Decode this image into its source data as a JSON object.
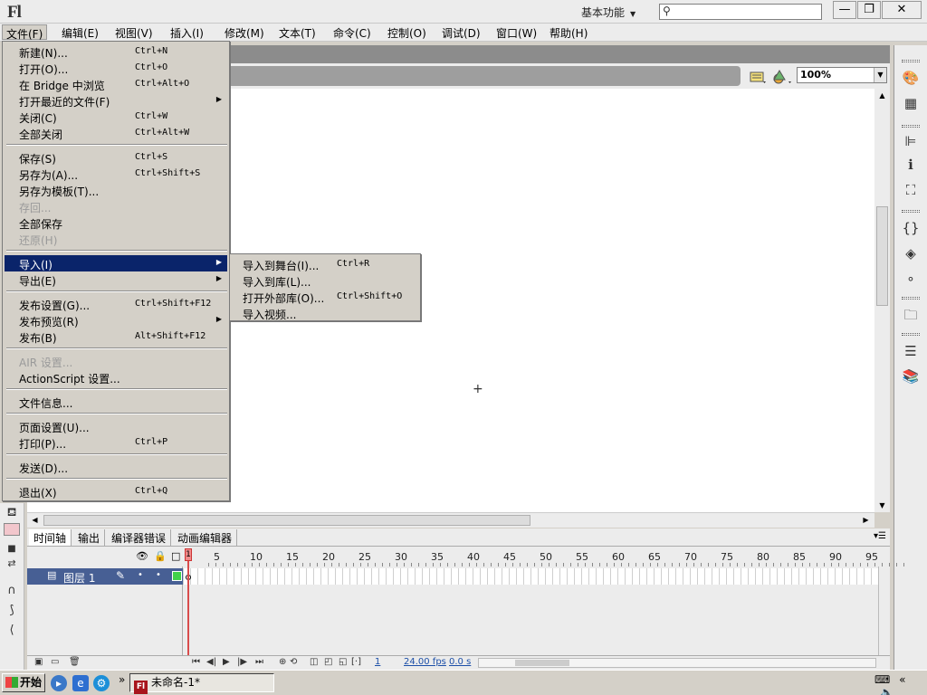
{
  "app": {
    "logo": "Fl",
    "workspace": "基本功能",
    "search_placeholder": "",
    "window_buttons": {
      "minimize": "—",
      "maximize": "❐",
      "close": "✕"
    }
  },
  "menubar": [
    "文件(F)",
    "编辑(E)",
    "视图(V)",
    "插入(I)",
    "修改(M)",
    "文本(T)",
    "命令(C)",
    "控制(O)",
    "调试(D)",
    "窗口(W)",
    "帮助(H)"
  ],
  "file_menu": [
    {
      "label": "新建(N)...",
      "shortcut": "Ctrl+N"
    },
    {
      "label": "打开(O)...",
      "shortcut": "Ctrl+O"
    },
    {
      "label": "在 Bridge 中浏览",
      "shortcut": "Ctrl+Alt+O"
    },
    {
      "label": "打开最近的文件(F)",
      "shortcut": ""
    },
    {
      "label": "关闭(C)",
      "shortcut": "Ctrl+W"
    },
    {
      "label": "全部关闭",
      "shortcut": "Ctrl+Alt+W"
    },
    {
      "label": "保存(S)",
      "shortcut": "Ctrl+S"
    },
    {
      "label": "另存为(A)...",
      "shortcut": "Ctrl+Shift+S"
    },
    {
      "label": "另存为模板(T)...",
      "shortcut": ""
    },
    {
      "label": "存回...",
      "shortcut": ""
    },
    {
      "label": "全部保存",
      "shortcut": ""
    },
    {
      "label": "还原(H)",
      "shortcut": ""
    },
    {
      "label": "导入(I)",
      "shortcut": ""
    },
    {
      "label": "导出(E)",
      "shortcut": ""
    },
    {
      "label": "发布设置(G)...",
      "shortcut": "Ctrl+Shift+F12"
    },
    {
      "label": "发布预览(R)",
      "shortcut": ""
    },
    {
      "label": "发布(B)",
      "shortcut": "Alt+Shift+F12"
    },
    {
      "label": "AIR 设置...",
      "shortcut": ""
    },
    {
      "label": "ActionScript 设置...",
      "shortcut": ""
    },
    {
      "label": "文件信息...",
      "shortcut": ""
    },
    {
      "label": "页面设置(U)...",
      "shortcut": ""
    },
    {
      "label": "打印(P)...",
      "shortcut": "Ctrl+P"
    },
    {
      "label": "发送(D)...",
      "shortcut": ""
    },
    {
      "label": "退出(X)",
      "shortcut": "Ctrl+Q"
    }
  ],
  "import_submenu": [
    {
      "label": "导入到舞台(I)...",
      "shortcut": "Ctrl+R"
    },
    {
      "label": "导入到库(L)...",
      "shortcut": ""
    },
    {
      "label": "打开外部库(O)...",
      "shortcut": "Ctrl+Shift+O"
    },
    {
      "label": "导入视频...",
      "shortcut": ""
    }
  ],
  "toolbar": {
    "zoom": "100%"
  },
  "timeline": {
    "tabs": [
      "时间轴",
      "输出",
      "编译器错误",
      "动画编辑器"
    ],
    "frame_numbers": [
      "5",
      "10",
      "15",
      "20",
      "25",
      "30",
      "35",
      "40",
      "45",
      "50",
      "55",
      "60",
      "65",
      "70",
      "75",
      "80",
      "85",
      "90",
      "95"
    ],
    "playhead_frame": "1",
    "layer_name": "图层 1",
    "current_frame": "1",
    "fps": "24.00 fps",
    "time": "0.0 s"
  },
  "taskbar": {
    "start": "开始",
    "task_label": "未命名-1*",
    "task_icon": "Fl"
  },
  "colors": {
    "highlight": "#0a246a",
    "layer_selected": "#475f94",
    "playhead": "#d94c4c",
    "layer_color": "#42d24b",
    "fill_swatch": "#f2c6cc"
  }
}
